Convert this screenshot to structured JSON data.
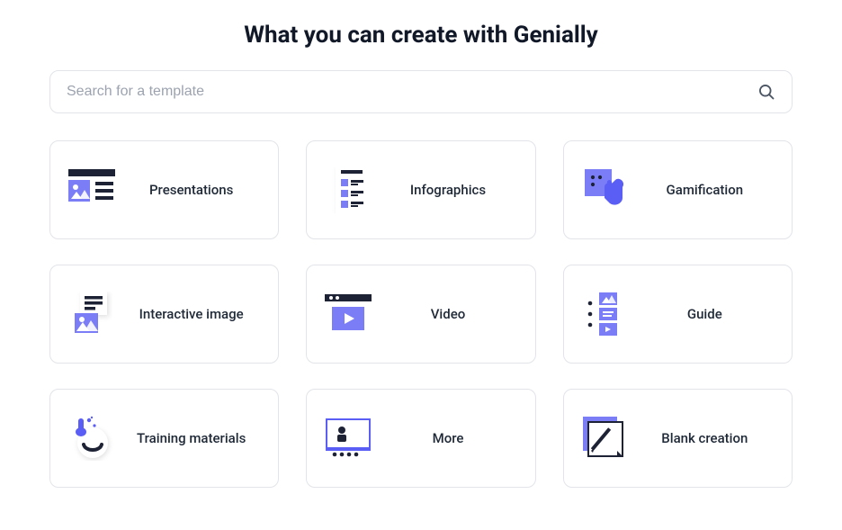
{
  "title": "What you can create with Genially",
  "search": {
    "placeholder": "Search for a template"
  },
  "colors": {
    "accent": "#5b5ef4",
    "dark": "#1e2235",
    "muted": "#9ca3af"
  },
  "cards": [
    {
      "label": "Presentations",
      "icon": "presentations-icon"
    },
    {
      "label": "Infographics",
      "icon": "infographics-icon"
    },
    {
      "label": "Gamification",
      "icon": "gamification-icon"
    },
    {
      "label": "Interactive image",
      "icon": "interactive-image-icon"
    },
    {
      "label": "Video",
      "icon": "video-icon"
    },
    {
      "label": "Guide",
      "icon": "guide-icon"
    },
    {
      "label": "Training materials",
      "icon": "training-materials-icon"
    },
    {
      "label": "More",
      "icon": "more-icon"
    },
    {
      "label": "Blank creation",
      "icon": "blank-creation-icon"
    }
  ]
}
